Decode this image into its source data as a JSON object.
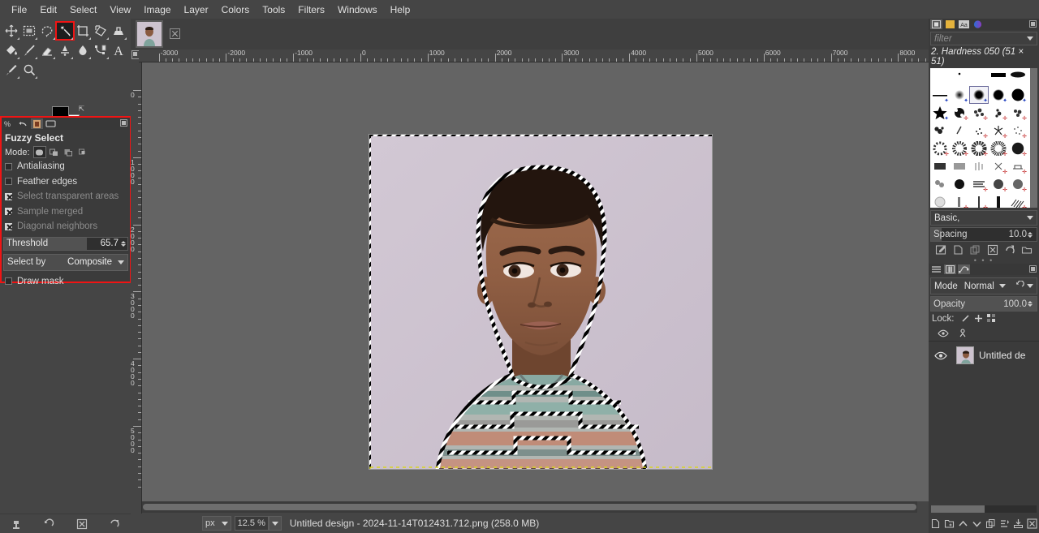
{
  "menubar": {
    "items": [
      "File",
      "Edit",
      "Select",
      "View",
      "Image",
      "Layer",
      "Colors",
      "Tools",
      "Filters",
      "Windows",
      "Help"
    ]
  },
  "toolbox": {
    "tools": [
      {
        "name": "move-tool",
        "icon": "move",
        "selected": false
      },
      {
        "name": "rectangle-select-tool",
        "icon": "rect-select",
        "selected": false
      },
      {
        "name": "free-select-tool",
        "icon": "lasso",
        "selected": false
      },
      {
        "name": "fuzzy-select-tool",
        "icon": "magic-wand",
        "selected": true
      },
      {
        "name": "crop-tool",
        "icon": "crop",
        "selected": false
      },
      {
        "name": "transform-tool",
        "icon": "transform",
        "selected": false
      },
      {
        "name": "clone-tool",
        "icon": "stamp",
        "selected": false
      },
      {
        "name": "bucket-fill-tool",
        "icon": "bucket",
        "selected": false
      },
      {
        "name": "paintbrush-tool",
        "icon": "brush",
        "selected": false
      },
      {
        "name": "eraser-tool",
        "icon": "eraser",
        "selected": false
      },
      {
        "name": "smudge-tool",
        "icon": "smudge",
        "selected": false
      },
      {
        "name": "blur-tool",
        "icon": "blur",
        "selected": false
      },
      {
        "name": "paths-tool",
        "icon": "paths",
        "selected": false
      },
      {
        "name": "text-tool",
        "icon": "text-A",
        "selected": false
      },
      {
        "name": "color-picker-tool",
        "icon": "eyedropper",
        "selected": false
      },
      {
        "name": "zoom-tool",
        "icon": "magnifier",
        "selected": false
      }
    ],
    "foreground_color": "#000000",
    "background_color": "#ffffff"
  },
  "tool_options": {
    "title": "Fuzzy Select",
    "mode_label": "Mode:",
    "modes": [
      "replace",
      "add",
      "subtract",
      "intersect"
    ],
    "mode_selected_index": 0,
    "checkboxes": [
      {
        "label": "Antialiasing",
        "state": "unchecked",
        "dim": false
      },
      {
        "label": "Feather edges",
        "state": "unchecked",
        "dim": false
      },
      {
        "label": "Select transparent areas",
        "state": "checked",
        "dim": true
      },
      {
        "label": "Sample merged",
        "state": "checked",
        "dim": true
      },
      {
        "label": "Diagonal neighbors",
        "state": "checked",
        "dim": true
      }
    ],
    "threshold": {
      "label": "Threshold",
      "value": "65.7",
      "fill_percent": 67
    },
    "select_by": {
      "label": "Select by",
      "value": "Composite"
    },
    "draw_mask": {
      "label": "Draw mask",
      "state": "unchecked"
    },
    "highlight_color": "#f01414"
  },
  "canvas": {
    "h_ruler_labels": [
      "-3000",
      "-2000",
      "-1000",
      "0",
      "1000",
      "2000",
      "3000",
      "4000",
      "5000",
      "6000",
      "7000",
      "8000"
    ],
    "v_ruler_labels": [
      "0",
      "1000",
      "2000",
      "3000",
      "4000",
      "5000"
    ],
    "selection_active": true,
    "image_background_color": "#cdc3cf"
  },
  "statusbar": {
    "unit": "px",
    "zoom": "12.5 %",
    "title": "Untitled design - 2024-11-14T012431.712.png (258.0 MB)",
    "left_icons": [
      "save-tool-preset-icon",
      "restore-tool-preset-icon",
      "delete-tool-preset-icon",
      "reset-tool-options-icon"
    ]
  },
  "right_dock": {
    "tabs": [
      "brushes-tab",
      "patterns-tab",
      "fonts-tab",
      "gradients-tab"
    ],
    "active_tab_index": 0,
    "filter_placeholder": "filter",
    "brush_name": "2. Hardness 050 (51 × 51)",
    "brush_tags": "Basic,",
    "spacing": {
      "label": "Spacing",
      "value": "10.0"
    },
    "brush_action_icons": [
      "edit-brush-icon",
      "new-brush-icon",
      "duplicate-brush-icon",
      "delete-brush-icon",
      "refresh-brushes-icon",
      "open-brush-folder-icon"
    ],
    "layers_tabs": [
      "layers-tab",
      "channels-tab",
      "paths-tab"
    ],
    "mode": {
      "label": "Mode",
      "value": "Normal"
    },
    "opacity": {
      "label": "Opacity",
      "value": "100.0"
    },
    "lock": {
      "label": "Lock:",
      "icons": [
        "lock-pixels-icon",
        "lock-position-icon",
        "lock-alpha-icon"
      ]
    },
    "layers": [
      {
        "name": "Untitled de",
        "visible": true,
        "selected": true
      }
    ],
    "layer_action_icons": [
      "new-layer-icon",
      "new-layer-group-icon",
      "raise-layer-icon",
      "lower-layer-icon",
      "duplicate-layer-icon",
      "anchor-layer-icon",
      "merge-down-icon",
      "delete-layer-icon"
    ]
  }
}
